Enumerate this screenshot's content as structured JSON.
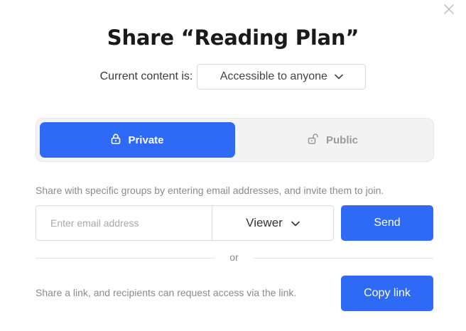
{
  "dialog": {
    "title": "Share “Reading Plan”",
    "close_icon": "close-icon"
  },
  "access": {
    "label": "Current content is:",
    "selected": "Accessible to anyone",
    "icon": "chevron-down-icon"
  },
  "visibility_toggle": {
    "private_label": "Private",
    "private_icon": "lock-icon",
    "public_label": "Public",
    "public_icon": "unlock-icon",
    "selected": "Private",
    "active_color": "#2e6af6"
  },
  "invite": {
    "description": "Share with specific groups by entering email addresses, and invite them to join.",
    "email_placeholder": "Enter email address",
    "email_value": "",
    "role_selected": "Viewer",
    "send_label": "Send"
  },
  "separator": {
    "text": "or"
  },
  "link_share": {
    "description": "Share a link, and recipients can request access via the link.",
    "copy_label": "Copy link"
  },
  "colors": {
    "accent": "#2e6af6",
    "muted_text": "#8a8a8a",
    "border": "#dcdcdc"
  }
}
